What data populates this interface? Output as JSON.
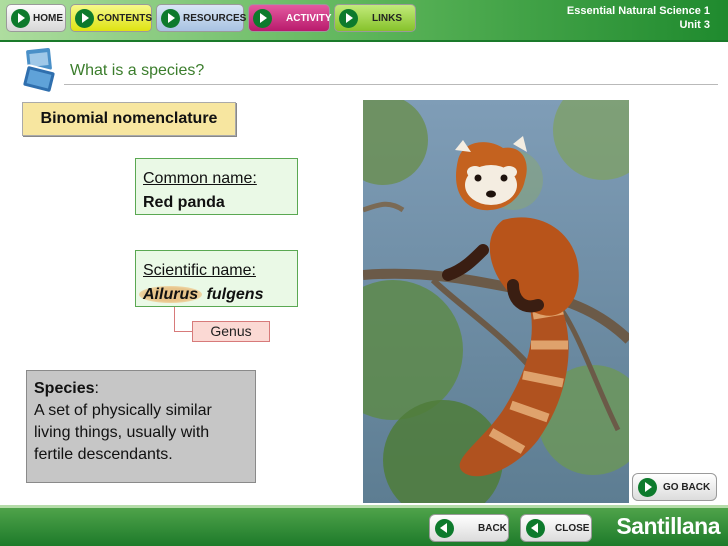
{
  "nav": {
    "home": "HOME",
    "contents": "CONTENTS",
    "resources": "RESOURCES",
    "activity": "ACTIVITY",
    "links": "LINKS"
  },
  "course": {
    "title": "Essential Natural Science 1",
    "unit": "Unit 3"
  },
  "page": {
    "title": "What is a species?"
  },
  "binomial": {
    "label": "Binomial nomenclature"
  },
  "common_name": {
    "label": "Common name:",
    "value": "Red panda"
  },
  "scientific_name": {
    "label": "Scientific name:",
    "genus": "Ailurus",
    "species": "fulgens"
  },
  "genus_tag": "Genus",
  "species_def": {
    "term": "Species",
    "colon": ":",
    "text": "A set of physically similar living things, usually with fertile descendants."
  },
  "buttons": {
    "go_back": "GO BACK",
    "back": "BACK",
    "close": "CLOSE"
  },
  "brand": "Santillana",
  "colors": {
    "header_green": "#1f8a2e",
    "title_green": "#3b7d2c",
    "binomial_bg": "#f7e6a0",
    "name_box_bg": "#eaf9e6",
    "genus_tag_bg": "#fbd9d4",
    "species_box_bg": "#c6c6c6"
  },
  "image": {
    "subject": "red-panda-on-branch-photo"
  }
}
